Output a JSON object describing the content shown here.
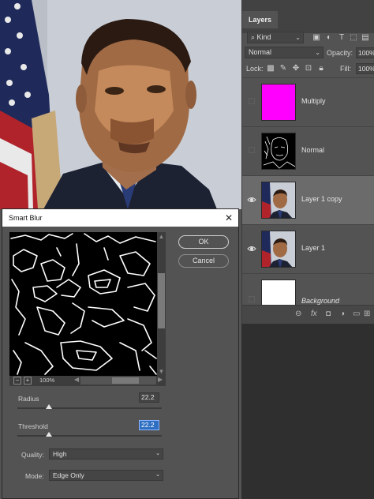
{
  "layers_panel": {
    "tab_label": "Layers",
    "filter_kind": "Kind",
    "blend_mode": "Normal",
    "opacity_label": "Opacity:",
    "opacity_value": "100%",
    "lock_label": "Lock:",
    "fill_label": "Fill:",
    "fill_value": "100%",
    "layers": [
      {
        "name": "Multiply",
        "visible": false,
        "selected": false,
        "thumb": "magenta-fill",
        "color": "#ff00ff"
      },
      {
        "name": "Normal",
        "visible": false,
        "selected": false,
        "thumb": "edge-sketch"
      },
      {
        "name": "Layer 1 copy",
        "visible": true,
        "selected": true,
        "thumb": "portrait-photo"
      },
      {
        "name": "Layer 1",
        "visible": true,
        "selected": false,
        "thumb": "portrait-photo"
      },
      {
        "name": "Background",
        "visible": false,
        "selected": false,
        "thumb": "white-fill",
        "italic": true
      }
    ],
    "footer_icons": [
      "link-icon",
      "fx-icon",
      "mask-icon",
      "adjustment-icon",
      "folder-icon",
      "new-layer-icon",
      "trash-icon"
    ]
  },
  "smart_blur": {
    "title": "Smart Blur",
    "close_glyph": "✕",
    "ok_label": "OK",
    "cancel_label": "Cancel",
    "zoom_minus": "−",
    "zoom_plus": "+",
    "zoom": "100%",
    "radius_label": "Radius",
    "radius_value": "22.2",
    "threshold_label": "Threshold",
    "threshold_value": "22.2",
    "radius_fraction": 0.22,
    "threshold_fraction": 0.22,
    "quality_label": "Quality:",
    "quality_value": "High",
    "mode_label": "Mode:",
    "mode_value": "Edge Only"
  },
  "colors": {
    "panel": "#535353",
    "selected_layer": "#6b6b6b",
    "accent_highlight": "#2f6fc2"
  }
}
